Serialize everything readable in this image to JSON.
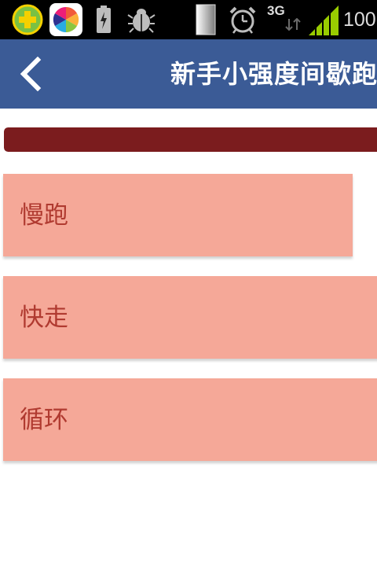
{
  "status_bar": {
    "icons": [
      "plus-app-icon",
      "colorful-app-icon",
      "battery-charging-icon",
      "bug-icon",
      "sim-card-icon",
      "alarm-icon",
      "network-3g-icon",
      "signal-icon"
    ],
    "network_type": "3G",
    "battery_text": "100"
  },
  "app_bar": {
    "back_icon": "chevron-left-icon",
    "title": "新手小强度间歇跑"
  },
  "progress": {
    "value_fraction": 1.0,
    "color": "#7b1c1e"
  },
  "list": {
    "items": [
      {
        "label": "慢跑"
      },
      {
        "label": "快走"
      },
      {
        "label": "循环"
      }
    ]
  },
  "colors": {
    "app_bar": "#3b5b96",
    "item_bg": "#f5a898",
    "item_text": "#b03a30"
  }
}
